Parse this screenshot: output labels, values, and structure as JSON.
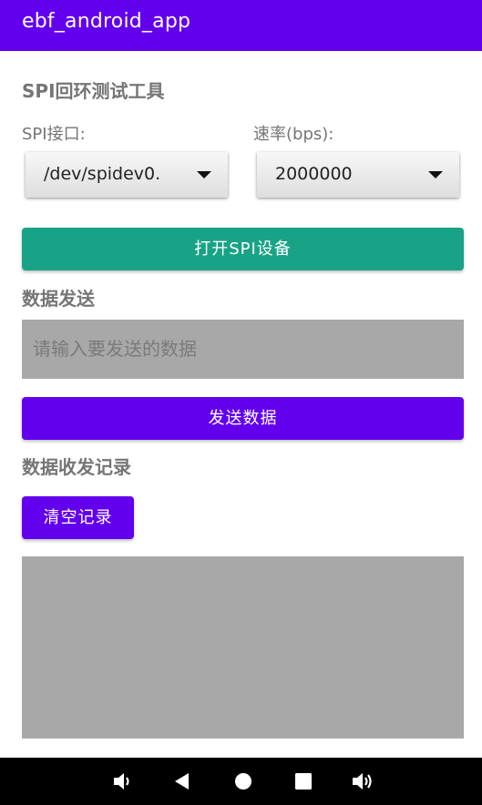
{
  "app_bar": {
    "title": "ebf_android_app"
  },
  "main": {
    "heading": "SPI回环测试工具",
    "spi_interface": {
      "label": "SPI接口:",
      "selected": "/dev/spidev0."
    },
    "baud_rate": {
      "label": "速率(bps):",
      "selected": "2000000"
    },
    "open_button": {
      "label": "打开SPI设备"
    },
    "send_section": {
      "title": "数据发送",
      "input_placeholder": "请输入要发送的数据",
      "send_button": "发送数据"
    },
    "log_section": {
      "title": "数据收发记录",
      "clear_button": "清空记录"
    }
  },
  "colors": {
    "primary": "#6200ee",
    "open_button": "#18a386",
    "field_background": "#a8a8a8"
  },
  "nav_bar": {
    "icons": [
      "volume-down-icon",
      "back-icon",
      "home-icon",
      "recents-icon",
      "volume-up-icon"
    ]
  }
}
